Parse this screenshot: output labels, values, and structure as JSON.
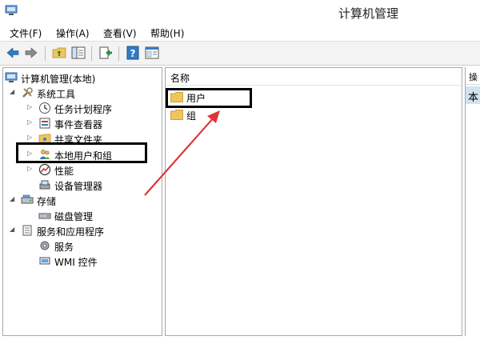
{
  "window": {
    "title": "计算机管理"
  },
  "menu": [
    {
      "label": "文件(F)"
    },
    {
      "label": "操作(A)"
    },
    {
      "label": "查看(V)"
    },
    {
      "label": "帮助(H)"
    }
  ],
  "toolbar": {
    "buttons": [
      {
        "icon": "back-arrow-icon"
      },
      {
        "icon": "forward-arrow-icon"
      },
      {
        "icon": "up-folder-icon"
      },
      {
        "icon": "show-tree-icon"
      },
      {
        "icon": "export-list-icon"
      },
      {
        "icon": "help-icon"
      },
      {
        "icon": "properties-icon"
      }
    ]
  },
  "tree": {
    "root": "计算机管理(本地)",
    "system_tools": "系统工具",
    "task_scheduler": "任务计划程序",
    "event_viewer": "事件查看器",
    "shared_folders": "共享文件夹",
    "local_users_groups": "本地用户和组",
    "performance": "性能",
    "device_manager": "设备管理器",
    "storage": "存储",
    "disk_management": "磁盘管理",
    "services_apps": "服务和应用程序",
    "services": "服务",
    "wmi_control": "WMI 控件"
  },
  "list": {
    "column_name": "名称",
    "items": [
      {
        "label": "用户"
      },
      {
        "label": "组"
      }
    ]
  },
  "actions": {
    "header": "操作",
    "selected": "本地用户和组"
  },
  "colors": {
    "annotation_arrow": "#e0353a",
    "annotation_box": "#000000",
    "folder": "#f2c55c",
    "selection": "#cfe3f2"
  }
}
